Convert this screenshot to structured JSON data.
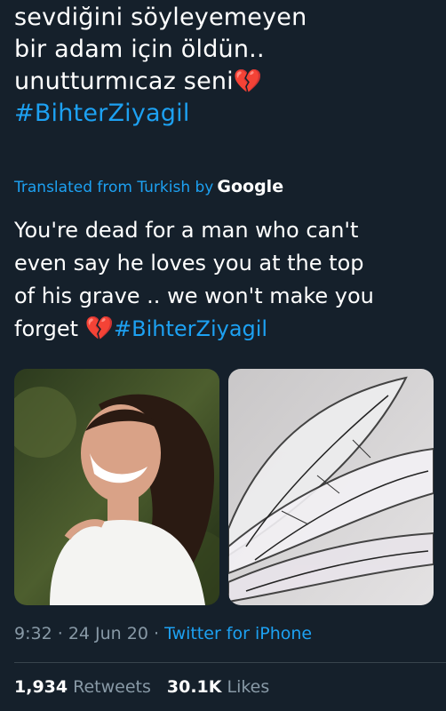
{
  "tweet": {
    "original_lines": [
      "sevdiğini söyleyemeyen",
      "bir adam için öldün..",
      "unutturmıcaz seni"
    ],
    "original_hashtag": "#BihterZiyagil",
    "heart_emoji": "💔",
    "translated_label": "Translated from Turkish by",
    "translator": "Google",
    "translation_lines": [
      "You're dead for a man who can't",
      "even say he loves you at the top",
      "of his grave .. we won't make you",
      "forget"
    ],
    "translation_hashtag": "#BihterZiyagil",
    "time": "9:32",
    "date": "24 Jun 20",
    "source": "Twitter for iPhone",
    "separator": "·"
  },
  "stats": {
    "retweets_count": "1,934",
    "retweets_label": "Retweets",
    "likes_count": "30.1K",
    "likes_label": "Likes"
  },
  "colors": {
    "background": "#15202b",
    "accent": "#1da1f2",
    "secondary_text": "#8899a6",
    "heart": "#e0245e"
  },
  "icons": [
    "broken-heart-icon"
  ]
}
